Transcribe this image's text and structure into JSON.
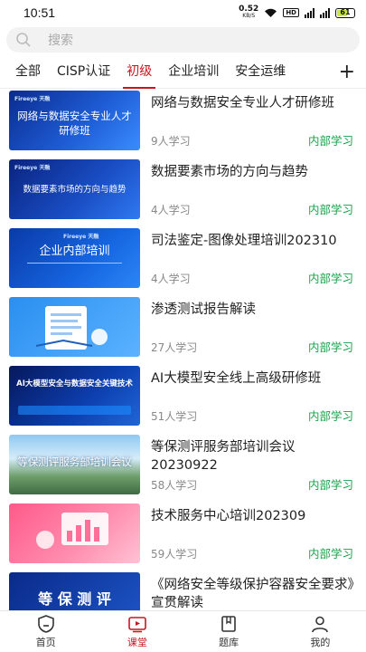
{
  "status": {
    "time": "10:51",
    "net_speed": "0.52",
    "net_unit": "KB/S",
    "hd": "HD",
    "battery": "61"
  },
  "search": {
    "placeholder": "搜索"
  },
  "tabs": [
    "全部",
    "CISP认证",
    "初级",
    "企业培训",
    "安全运维"
  ],
  "active_tab": "初级",
  "colors": {
    "accent": "#c8161d",
    "tag": "#16a34a"
  },
  "courses": [
    {
      "title": "网络与数据安全专业人才研修班",
      "count": "9人学习",
      "tag": "内部学习",
      "thumb_text": "网络与数据安全专业人才\n研修班"
    },
    {
      "title": "数据要素市场的方向与趋势",
      "count": "4人学习",
      "tag": "内部学习",
      "thumb_text": "数据要素市场的方向与趋势"
    },
    {
      "title": "司法鉴定-图像处理培训202310",
      "count": "4人学习",
      "tag": "内部学习",
      "thumb_text": "企业内部培训"
    },
    {
      "title": "渗透测试报告解读",
      "count": "27人学习",
      "tag": "内部学习",
      "thumb_text": ""
    },
    {
      "title": "AI大模型安全线上高级研修班",
      "count": "51人学习",
      "tag": "内部学习",
      "thumb_text": "AI大模型安全与数据安全关键技术"
    },
    {
      "title": "等保测评服务部培训会议20230922",
      "count": "58人学习",
      "tag": "内部学习",
      "thumb_text": "等保测评服务部培训会议"
    },
    {
      "title": "技术服务中心培训202309",
      "count": "59人学习",
      "tag": "内部学习",
      "thumb_text": ""
    },
    {
      "title": "《网络安全等级保护容器安全要求》宣贯解读",
      "count": "",
      "tag": "",
      "thumb_text": "等 保 测 评"
    }
  ],
  "bottom_nav": [
    {
      "label": "首页",
      "icon": "home-shield-icon"
    },
    {
      "label": "课堂",
      "icon": "video-play-icon"
    },
    {
      "label": "题库",
      "icon": "book-icon"
    },
    {
      "label": "我的",
      "icon": "user-icon"
    }
  ]
}
